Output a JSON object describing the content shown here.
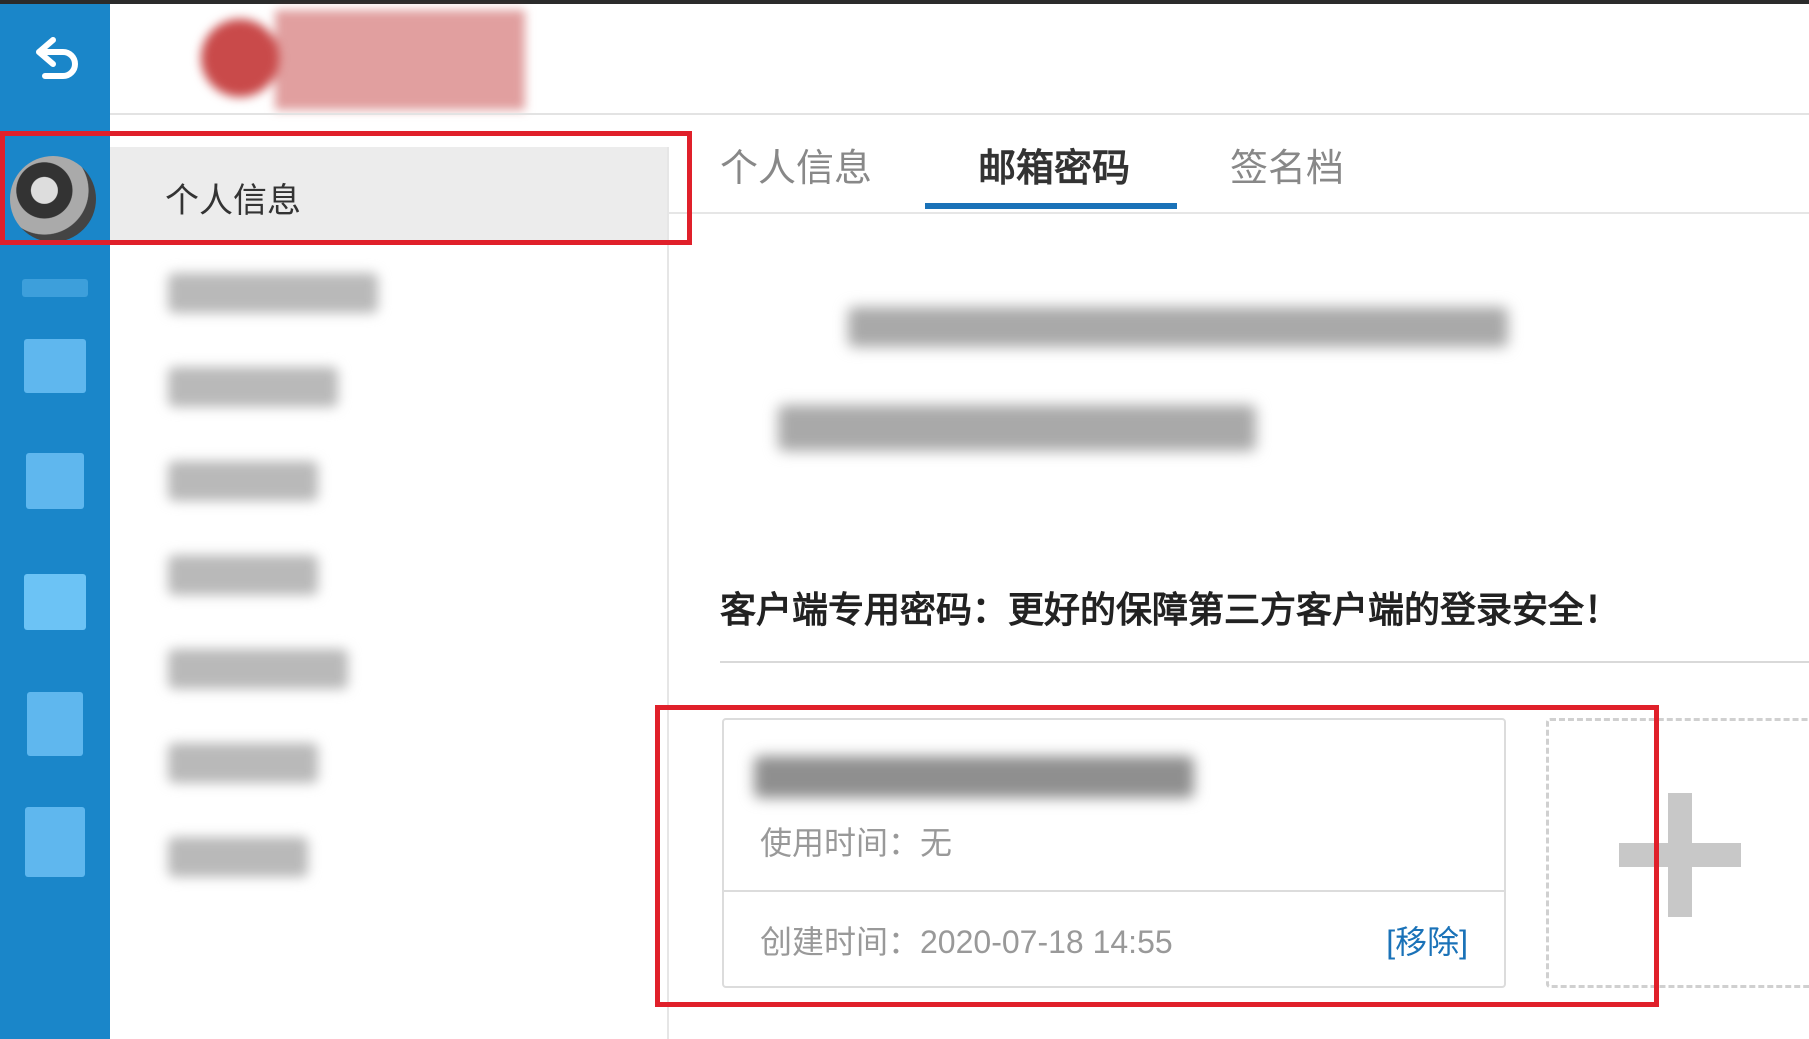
{
  "menu": {
    "items": [
      {
        "label": "个人信息",
        "active": true
      }
    ]
  },
  "tabs": [
    {
      "label": "个人信息",
      "active": false
    },
    {
      "label": "邮箱密码",
      "active": true
    },
    {
      "label": "签名档",
      "active": false
    }
  ],
  "client_password": {
    "heading": "客户端专用密码：更好的保障第三方客户端的登录安全！",
    "card": {
      "usage_text": "使用时间：无",
      "created_text": "创建时间：2020-07-18 14:55",
      "remove_label": "[移除]"
    },
    "add_icon": "plus-icon"
  },
  "colors": {
    "rail": "#1a86c9",
    "accent": "#1a72b8",
    "highlight": "#e0202a"
  }
}
